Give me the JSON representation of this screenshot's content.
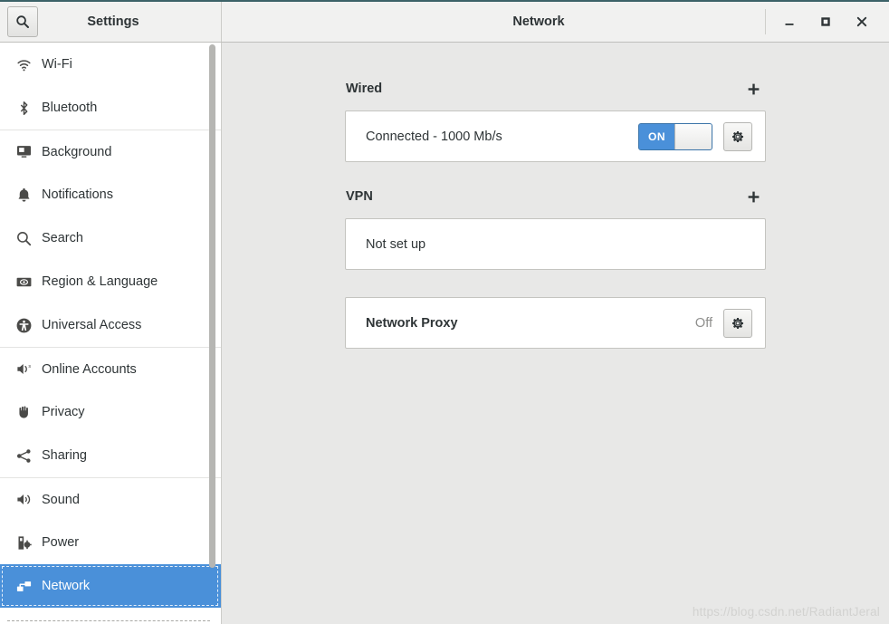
{
  "window": {
    "app_title": "Settings",
    "page_title": "Network",
    "search_icon": "search-icon",
    "controls": {
      "minimize": "–",
      "maximize": "□",
      "close": "×"
    }
  },
  "sidebar": {
    "items": [
      {
        "label": "Wi-Fi",
        "icon": "wifi-icon",
        "selected": false,
        "divider_above": false
      },
      {
        "label": "Bluetooth",
        "icon": "bluetooth-icon",
        "selected": false,
        "divider_above": false
      },
      {
        "label": "Background",
        "icon": "background-icon",
        "selected": false,
        "divider_above": true
      },
      {
        "label": "Notifications",
        "icon": "bell-icon",
        "selected": false,
        "divider_above": false
      },
      {
        "label": "Search",
        "icon": "search-icon",
        "selected": false,
        "divider_above": false
      },
      {
        "label": "Region & Language",
        "icon": "region-language-icon",
        "selected": false,
        "divider_above": false
      },
      {
        "label": "Universal Access",
        "icon": "universal-access-icon",
        "selected": false,
        "divider_above": false
      },
      {
        "label": "Online Accounts",
        "icon": "online-accounts-icon",
        "selected": false,
        "divider_above": true
      },
      {
        "label": "Privacy",
        "icon": "privacy-hand-icon",
        "selected": false,
        "divider_above": false
      },
      {
        "label": "Sharing",
        "icon": "sharing-icon",
        "selected": false,
        "divider_above": false
      },
      {
        "label": "Sound",
        "icon": "sound-icon",
        "selected": false,
        "divider_above": true
      },
      {
        "label": "Power",
        "icon": "power-icon",
        "selected": false,
        "divider_above": false
      },
      {
        "label": "Network",
        "icon": "network-icon",
        "selected": true,
        "divider_above": false
      }
    ]
  },
  "content": {
    "wired": {
      "title": "Wired",
      "add_label": "+",
      "status": "Connected - 1000 Mb/s",
      "toggle_state": "ON",
      "settings_icon": "gear-icon"
    },
    "vpn": {
      "title": "VPN",
      "add_label": "+",
      "status": "Not set up"
    },
    "proxy": {
      "title": "Network Proxy",
      "status": "Off",
      "settings_icon": "gear-icon"
    }
  },
  "watermark": {
    "text": "https://blog.csdn.net/RadiantJeral"
  },
  "colors": {
    "accent": "#4a90d9",
    "titlebar_accent": "#3c6268",
    "content_bg": "#e8e8e7",
    "sidebar_bg": "#ffffff"
  }
}
